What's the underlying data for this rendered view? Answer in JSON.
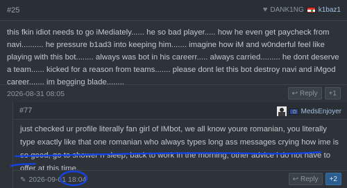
{
  "post1": {
    "number": "#25",
    "upvoter": "DANK1NG",
    "username": "k1baz1",
    "body": "this fkin idiot needs to go iMediately...... he so bad player..... how he even get paycheck from navi.......... he pressure b1ad3 into keeping him....... imagine how iM and w0nderful feel like playing with this bot........ always was bot in his careerr..... always carried......... he dont deserve a team...... kicked for a reason from teams....... please dont let this bot destroy navi and iMgod career....... im begging blade........",
    "date": "2026-08-31 08:05",
    "reply_label": "Reply",
    "vote_label": "+1"
  },
  "post2": {
    "number": "#77",
    "username": "MedsEnjoyer",
    "body": "just checked ur profile literally fan girl of IMbot, we all know youre romanian, you literally type exactly like that one romanian who always types long ass messages crying how ime is so good, go to shower n sleep, back to work in the morning, other advice i do not have to offer at this time.",
    "date": "2026-09-01",
    "time": "18:04",
    "reply_label": "Reply",
    "vote_label": "+2"
  },
  "icons": {
    "heart": "heart-icon",
    "reply": "reply-icon",
    "edit": "pencil-icon",
    "flag_lb": "lebanon-flag-icon",
    "flag_eu": "eu-flag-icon",
    "avatar": "user-avatar"
  },
  "colors": {
    "accent": "#2b5e8e",
    "annotation": "#1443e0"
  }
}
